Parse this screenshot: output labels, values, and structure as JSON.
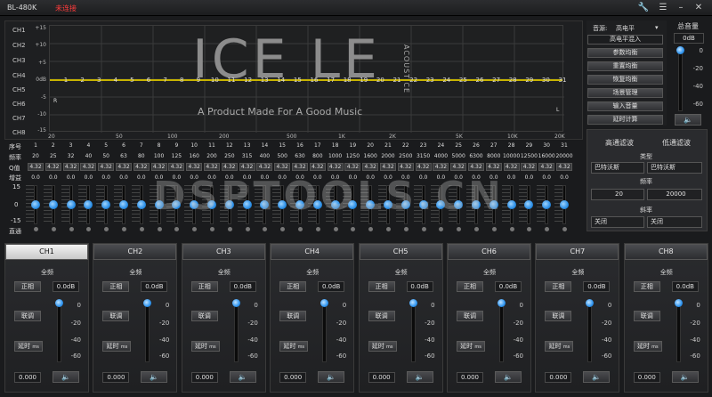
{
  "titlebar": {
    "title": "BL-480K",
    "status": "未连接",
    "status_color": "#ff3b3b"
  },
  "graph": {
    "channels": [
      "CH1",
      "CH2",
      "CH3",
      "CH4",
      "CH5",
      "CH6",
      "CH7",
      "CH8"
    ],
    "db_ticks": [
      "+15",
      "+10",
      "+5",
      "0dB",
      "-5",
      "-10",
      "-15"
    ],
    "freq_ticks": [
      "20",
      "50",
      "100",
      "200",
      "500",
      "1K",
      "2K",
      "5K",
      "10K",
      "20K"
    ],
    "watermark": "ICE LE",
    "watermark_side": "ACOUSTICE",
    "tagline": "A Product Made For A Good Music",
    "left_marker": "R",
    "right_marker": "L",
    "curve_color": "#c8b400"
  },
  "eq": {
    "row_labels": {
      "index": "序号",
      "freq": "频率",
      "q": "Q值",
      "gain": "增益",
      "top": "15",
      "mid": "0",
      "bottom": "-15",
      "bypass": "直通"
    },
    "bands": [
      "1",
      "2",
      "3",
      "4",
      "5",
      "6",
      "7",
      "8",
      "9",
      "10",
      "11",
      "12",
      "13",
      "14",
      "15",
      "16",
      "17",
      "18",
      "19",
      "20",
      "21",
      "22",
      "23",
      "24",
      "25",
      "26",
      "27",
      "28",
      "29",
      "30",
      "31"
    ],
    "freqs": [
      "20",
      "25",
      "32",
      "40",
      "50",
      "63",
      "80",
      "100",
      "125",
      "160",
      "200",
      "250",
      "315",
      "400",
      "500",
      "630",
      "800",
      "1000",
      "1250",
      "1600",
      "2000",
      "2500",
      "3150",
      "4000",
      "5000",
      "6300",
      "8000",
      "10000",
      "12500",
      "16000",
      "20000"
    ],
    "q": [
      "4.32",
      "4.32",
      "4.32",
      "4.32",
      "4.32",
      "4.32",
      "4.32",
      "4.32",
      "4.32",
      "4.32",
      "4.32",
      "4.32",
      "4.32",
      "4.32",
      "4.32",
      "4.32",
      "4.32",
      "4.32",
      "4.32",
      "4.32",
      "4.32",
      "4.32",
      "4.32",
      "4.32",
      "4.32",
      "4.32",
      "4.32",
      "4.32",
      "4.32",
      "4.32",
      "4.32"
    ],
    "gain": [
      "0.0",
      "0.0",
      "0.0",
      "0.0",
      "0.0",
      "0.0",
      "0.0",
      "0.0",
      "0.0",
      "0.0",
      "0.0",
      "0.0",
      "0.0",
      "0.0",
      "0.0",
      "0.0",
      "0.0",
      "0.0",
      "0.0",
      "0.0",
      "0.0",
      "0.0",
      "0.0",
      "0.0",
      "0.0",
      "0.0",
      "0.0",
      "0.0",
      "0.0",
      "0.0",
      "0.0"
    ]
  },
  "source": {
    "label": "音源:",
    "value": "高电平",
    "mix": "高电平混入"
  },
  "menu": [
    "参数均衡",
    "重置均衡",
    "恢复均衡",
    "场景管理",
    "输入音量",
    "延时计算"
  ],
  "master": {
    "title": "总音量",
    "value": "0dB",
    "scale": [
      "0",
      "-20",
      "-40",
      "-60"
    ],
    "mute_icon": "🔈"
  },
  "filter": {
    "hp_title": "高通滤波",
    "lp_title": "低通滤波",
    "type_label": "类型",
    "hp_type": "巴特沃斯",
    "lp_type": "巴特沃斯",
    "freq_label": "频率",
    "hp_freq": "20",
    "lp_freq": "20000",
    "slope_label": "斜率",
    "hp_slope": "关闭",
    "lp_slope": "关闭"
  },
  "overlay_watermark": "DSPTOOLS.CN",
  "channels": [
    {
      "tab": "CH1",
      "section": "全频",
      "phase": "正相",
      "gain": "0.0dB",
      "link": "联调",
      "delay": "延时",
      "unit": "ms",
      "delay_val": "0.000"
    },
    {
      "tab": "CH2",
      "section": "全频",
      "phase": "正相",
      "gain": "0.0dB",
      "link": "联调",
      "delay": "延时",
      "unit": "ms",
      "delay_val": "0.000"
    },
    {
      "tab": "CH3",
      "section": "全频",
      "phase": "正相",
      "gain": "0.0dB",
      "link": "联调",
      "delay": "延时",
      "unit": "ms",
      "delay_val": "0.000"
    },
    {
      "tab": "CH4",
      "section": "全频",
      "phase": "正相",
      "gain": "0.0dB",
      "link": "联调",
      "delay": "延时",
      "unit": "ms",
      "delay_val": "0.000"
    },
    {
      "tab": "CH5",
      "section": "全频",
      "phase": "正相",
      "gain": "0.0dB",
      "link": "联调",
      "delay": "延时",
      "unit": "ms",
      "delay_val": "0.000"
    },
    {
      "tab": "CH6",
      "section": "全频",
      "phase": "正相",
      "gain": "0.0dB",
      "link": "联调",
      "delay": "延时",
      "unit": "ms",
      "delay_val": "0.000"
    },
    {
      "tab": "CH7",
      "section": "全频",
      "phase": "正相",
      "gain": "0.0dB",
      "link": "联调",
      "delay": "延时",
      "unit": "ms",
      "delay_val": "0.000"
    },
    {
      "tab": "CH8",
      "section": "全频",
      "phase": "正相",
      "gain": "0.0dB",
      "link": "联调",
      "delay": "延时",
      "unit": "ms",
      "delay_val": "0.000"
    }
  ],
  "channel_scale": [
    "0",
    "-20",
    "-40",
    "-60"
  ],
  "active_channel": "CH1",
  "colors": {
    "accent": "#2a8ee6",
    "curve": "#c8b400",
    "status": "#ff3b3b"
  }
}
